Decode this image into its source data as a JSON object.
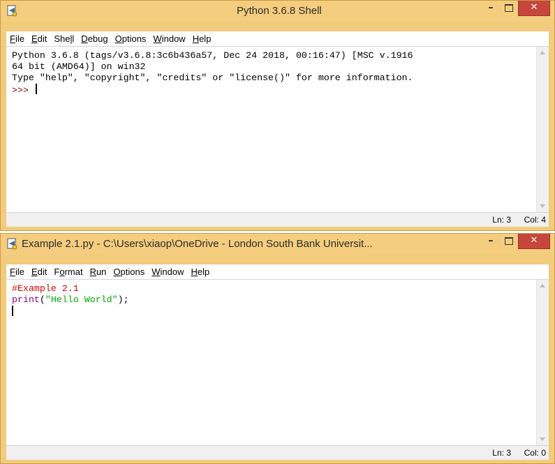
{
  "shell_window": {
    "title": "Python 3.6.8 Shell",
    "menu": [
      {
        "pre": "",
        "u": "F",
        "post": "ile"
      },
      {
        "pre": "",
        "u": "E",
        "post": "dit"
      },
      {
        "pre": "She",
        "u": "l",
        "post": "l"
      },
      {
        "pre": "",
        "u": "D",
        "post": "ebug"
      },
      {
        "pre": "",
        "u": "O",
        "post": "ptions"
      },
      {
        "pre": "",
        "u": "W",
        "post": "indow"
      },
      {
        "pre": "",
        "u": "H",
        "post": "elp"
      }
    ],
    "lines": [
      "Python 3.6.8 (tags/v3.6.8:3c6b436a57, Dec 24 2018, 00:16:47) [MSC v.1916",
      "64 bit (AMD64)] on win32",
      "Type \"help\", \"copyright\", \"credits\" or \"license()\" for more information."
    ],
    "prompt": ">>>",
    "status": {
      "ln": "Ln: 3",
      "col": "Col: 4"
    }
  },
  "editor_window": {
    "title": "Example 2.1.py - C:\\Users\\xiaop\\OneDrive - London South Bank Universit...",
    "menu": [
      {
        "pre": "",
        "u": "F",
        "post": "ile"
      },
      {
        "pre": "",
        "u": "E",
        "post": "dit"
      },
      {
        "pre": "F",
        "u": "o",
        "post": "rmat"
      },
      {
        "pre": "",
        "u": "R",
        "post": "un"
      },
      {
        "pre": "",
        "u": "O",
        "post": "ptions"
      },
      {
        "pre": "",
        "u": "W",
        "post": "indow"
      },
      {
        "pre": "",
        "u": "H",
        "post": "elp"
      }
    ],
    "comment_line": "#Example 2.1",
    "print_fn": "print",
    "open_paren": "(",
    "string_literal": "\"Hello World\"",
    "close": ");",
    "status": {
      "ln": "Ln: 3",
      "col": "Col: 0"
    }
  },
  "controls": {
    "minimize": "–",
    "close": "✕"
  },
  "icons": {
    "app": "python-idle-icon"
  }
}
